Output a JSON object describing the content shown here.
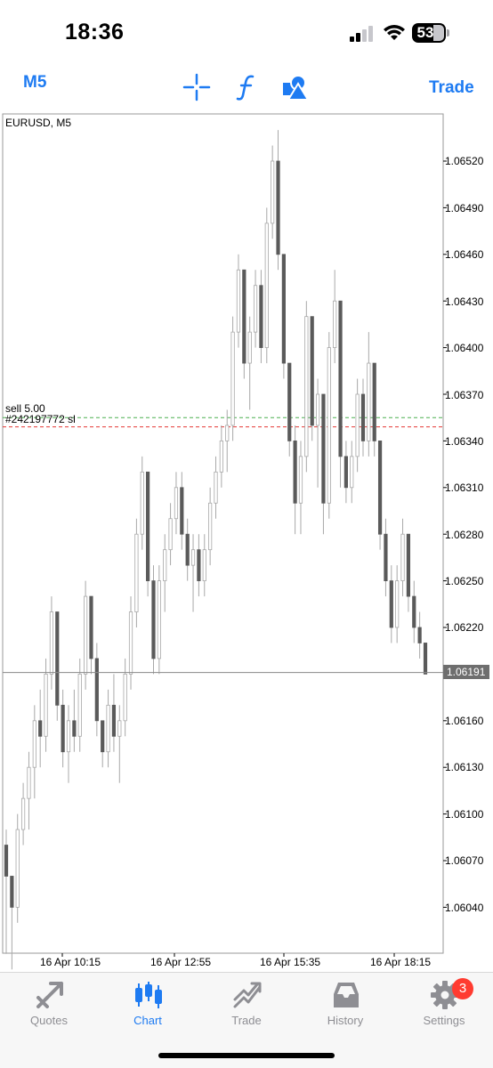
{
  "status_bar": {
    "time": "18:36",
    "battery": "53"
  },
  "toolbar": {
    "timeframe": "M5",
    "trade_label": "Trade",
    "icons": [
      "crosshair-icon",
      "function-icon",
      "objects-icon"
    ],
    "accent": "#1e7bf2"
  },
  "chart": {
    "title": "EURUSD, M5",
    "order_text": "sell 5.00",
    "order_ticket": "#242197772 sl",
    "current_price": "1.06191",
    "price_labels": [
      "1.06520",
      "1.06490",
      "1.06460",
      "1.06430",
      "1.06400",
      "1.06370",
      "1.06340",
      "1.06310",
      "1.06280",
      "1.06250",
      "1.06220",
      "1.06160",
      "1.06130",
      "1.06100",
      "1.06070",
      "1.06040"
    ],
    "time_labels": [
      "16 Apr 10:15",
      "16 Apr 12:55",
      "16 Apr 15:35",
      "16 Apr 18:15"
    ]
  },
  "chart_data": {
    "type": "candlestick",
    "title": "EURUSD, M5",
    "ylim": [
      1.0601,
      1.0655
    ],
    "current_price": 1.06191,
    "order_levels": {
      "sell": 1.06355,
      "sl": 1.06349
    },
    "colors": {
      "bull": "#ffffff",
      "bear": "#5a5a5a",
      "wick": "#a8a8a8",
      "sell_line": "#4caf50",
      "sl_line": "#e53935"
    },
    "candles": [
      [
        1.0608,
        1.0609,
        1.0601,
        1.0606
      ],
      [
        1.0606,
        1.0606,
        1.06,
        1.0604
      ],
      [
        1.0604,
        1.061,
        1.0603,
        1.0609
      ],
      [
        1.0609,
        1.0612,
        1.0608,
        1.0611
      ],
      [
        1.0611,
        1.0614,
        1.0609,
        1.0613
      ],
      [
        1.0613,
        1.0617,
        1.0611,
        1.0616
      ],
      [
        1.0616,
        1.0618,
        1.0613,
        1.0615
      ],
      [
        1.0615,
        1.062,
        1.0614,
        1.0619
      ],
      [
        1.0619,
        1.0624,
        1.0618,
        1.0623
      ],
      [
        1.0623,
        1.0623,
        1.0616,
        1.0617
      ],
      [
        1.0617,
        1.0618,
        1.0613,
        1.0614
      ],
      [
        1.0614,
        1.0617,
        1.0612,
        1.0616
      ],
      [
        1.0616,
        1.0618,
        1.0614,
        1.0615
      ],
      [
        1.0615,
        1.062,
        1.0614,
        1.0619
      ],
      [
        1.0619,
        1.0625,
        1.0618,
        1.0624
      ],
      [
        1.0624,
        1.0624,
        1.0619,
        1.062
      ],
      [
        1.062,
        1.0621,
        1.0615,
        1.0616
      ],
      [
        1.0616,
        1.0616,
        1.0613,
        1.0614
      ],
      [
        1.0614,
        1.0618,
        1.0613,
        1.0617
      ],
      [
        1.0617,
        1.0619,
        1.0614,
        1.0615
      ],
      [
        1.0615,
        1.0617,
        1.0612,
        1.0616
      ],
      [
        1.0616,
        1.062,
        1.0615,
        1.0619
      ],
      [
        1.0619,
        1.0624,
        1.0618,
        1.0623
      ],
      [
        1.0623,
        1.0629,
        1.0622,
        1.0628
      ],
      [
        1.0628,
        1.0633,
        1.0627,
        1.0632
      ],
      [
        1.0632,
        1.0632,
        1.0624,
        1.0625
      ],
      [
        1.0625,
        1.0626,
        1.0619,
        1.062
      ],
      [
        1.062,
        1.0626,
        1.0619,
        1.0625
      ],
      [
        1.0625,
        1.0628,
        1.0623,
        1.0627
      ],
      [
        1.0627,
        1.063,
        1.0626,
        1.0629
      ],
      [
        1.0629,
        1.0632,
        1.0628,
        1.0631
      ],
      [
        1.0631,
        1.0632,
        1.0627,
        1.0628
      ],
      [
        1.0628,
        1.0629,
        1.0625,
        1.0626
      ],
      [
        1.0626,
        1.0628,
        1.0623,
        1.0627
      ],
      [
        1.0627,
        1.0628,
        1.0624,
        1.0625
      ],
      [
        1.0625,
        1.0628,
        1.0624,
        1.0627
      ],
      [
        1.0627,
        1.0631,
        1.0626,
        1.063
      ],
      [
        1.063,
        1.0633,
        1.0629,
        1.0632
      ],
      [
        1.0632,
        1.0635,
        1.0631,
        1.0634
      ],
      [
        1.0634,
        1.0636,
        1.0632,
        1.0635
      ],
      [
        1.0635,
        1.0642,
        1.0634,
        1.0641
      ],
      [
        1.0641,
        1.0646,
        1.064,
        1.0645
      ],
      [
        1.0645,
        1.0645,
        1.0638,
        1.0639
      ],
      [
        1.0639,
        1.0642,
        1.0636,
        1.0641
      ],
      [
        1.0641,
        1.0645,
        1.064,
        1.0644
      ],
      [
        1.0644,
        1.0645,
        1.0639,
        1.064
      ],
      [
        1.064,
        1.0649,
        1.0639,
        1.0648
      ],
      [
        1.0648,
        1.0653,
        1.0647,
        1.0652
      ],
      [
        1.0652,
        1.0654,
        1.0645,
        1.0646
      ],
      [
        1.0646,
        1.0646,
        1.0638,
        1.0639
      ],
      [
        1.0639,
        1.0639,
        1.0633,
        1.0634
      ],
      [
        1.0634,
        1.0635,
        1.0628,
        1.063
      ],
      [
        1.063,
        1.0634,
        1.0628,
        1.0633
      ],
      [
        1.0633,
        1.0643,
        1.0632,
        1.0642
      ],
      [
        1.0642,
        1.0642,
        1.0634,
        1.0635
      ],
      [
        1.0635,
        1.0638,
        1.0631,
        1.0637
      ],
      [
        1.0637,
        1.0637,
        1.0628,
        1.063
      ],
      [
        1.063,
        1.0641,
        1.0629,
        1.064
      ],
      [
        1.064,
        1.0645,
        1.0639,
        1.0643
      ],
      [
        1.0643,
        1.0643,
        1.0631,
        1.0633
      ],
      [
        1.0633,
        1.0634,
        1.063,
        1.0631
      ],
      [
        1.0631,
        1.0634,
        1.063,
        1.0633
      ],
      [
        1.0633,
        1.0638,
        1.0632,
        1.0637
      ],
      [
        1.0637,
        1.0638,
        1.0633,
        1.0634
      ],
      [
        1.0634,
        1.0641,
        1.0633,
        1.0639
      ],
      [
        1.0639,
        1.0639,
        1.0633,
        1.0634
      ],
      [
        1.0634,
        1.0634,
        1.0627,
        1.0628
      ],
      [
        1.0628,
        1.0629,
        1.0624,
        1.0625
      ],
      [
        1.0625,
        1.0626,
        1.0621,
        1.0622
      ],
      [
        1.0622,
        1.0626,
        1.0621,
        1.0625
      ],
      [
        1.0625,
        1.0629,
        1.0624,
        1.0628
      ],
      [
        1.0628,
        1.0628,
        1.0623,
        1.0624
      ],
      [
        1.0624,
        1.0625,
        1.0621,
        1.0622
      ],
      [
        1.0622,
        1.0623,
        1.062,
        1.0621
      ],
      [
        1.0621,
        1.0621,
        1.0619,
        1.0619
      ]
    ]
  },
  "tabs": [
    {
      "label": "Quotes",
      "icon": "quotes-icon"
    },
    {
      "label": "Chart",
      "icon": "chart-icon"
    },
    {
      "label": "Trade",
      "icon": "trade-icon"
    },
    {
      "label": "History",
      "icon": "history-icon"
    },
    {
      "label": "Settings",
      "icon": "settings-icon",
      "badge": "3"
    }
  ]
}
